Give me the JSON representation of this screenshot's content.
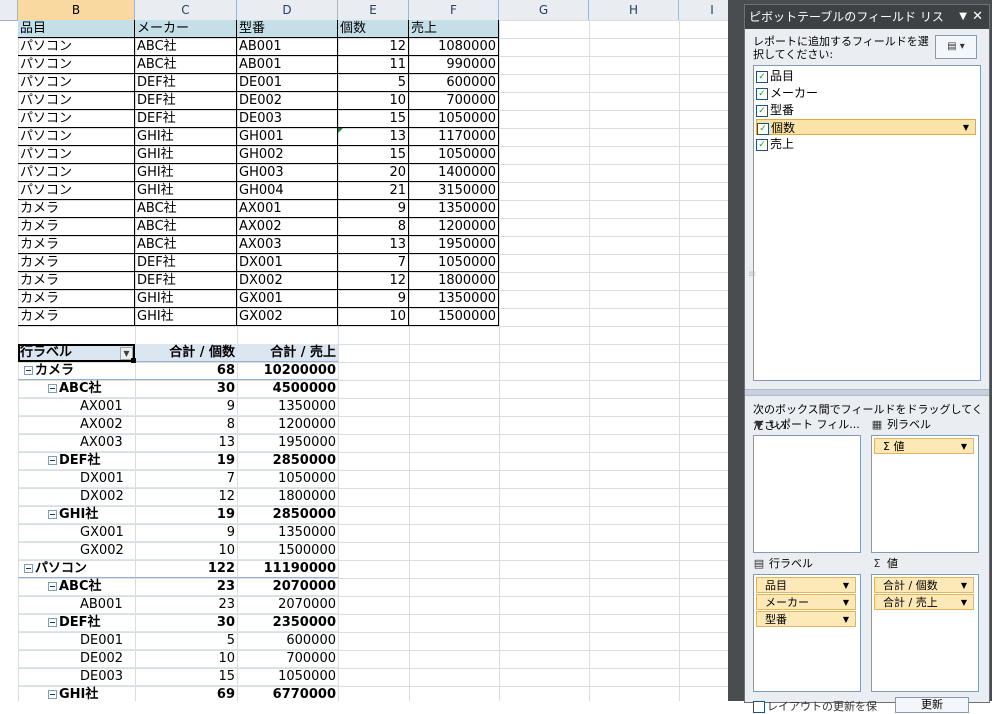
{
  "columns": [
    {
      "letter": "B",
      "active": true
    },
    {
      "letter": "C",
      "active": false
    },
    {
      "letter": "D",
      "active": false
    },
    {
      "letter": "E",
      "active": false
    },
    {
      "letter": "F",
      "active": false
    },
    {
      "letter": "G",
      "active": false
    },
    {
      "letter": "H",
      "active": false
    },
    {
      "letter": "I",
      "active": false
    }
  ],
  "table": {
    "headers": [
      "品目",
      "メーカー",
      "型番",
      "個数",
      "売上"
    ],
    "rows": [
      [
        "パソコン",
        "ABC社",
        "AB001",
        "12",
        "1080000"
      ],
      [
        "パソコン",
        "ABC社",
        "AB001",
        "11",
        "990000"
      ],
      [
        "パソコン",
        "DEF社",
        "DE001",
        "5",
        "600000"
      ],
      [
        "パソコン",
        "DEF社",
        "DE002",
        "10",
        "700000"
      ],
      [
        "パソコン",
        "DEF社",
        "DE003",
        "15",
        "1050000"
      ],
      [
        "パソコン",
        "GHI社",
        "GH001",
        "13",
        "1170000"
      ],
      [
        "パソコン",
        "GHI社",
        "GH002",
        "15",
        "1050000"
      ],
      [
        "パソコン",
        "GHI社",
        "GH003",
        "20",
        "1400000"
      ],
      [
        "パソコン",
        "GHI社",
        "GH004",
        "21",
        "3150000"
      ],
      [
        "カメラ",
        "ABC社",
        "AX001",
        "9",
        "1350000"
      ],
      [
        "カメラ",
        "ABC社",
        "AX002",
        "8",
        "1200000"
      ],
      [
        "カメラ",
        "ABC社",
        "AX003",
        "13",
        "1950000"
      ],
      [
        "カメラ",
        "DEF社",
        "DX001",
        "7",
        "1050000"
      ],
      [
        "カメラ",
        "DEF社",
        "DX002",
        "12",
        "1800000"
      ],
      [
        "カメラ",
        "GHI社",
        "GX001",
        "9",
        "1350000"
      ],
      [
        "カメラ",
        "GHI社",
        "GX002",
        "10",
        "1500000"
      ]
    ]
  },
  "pivot": {
    "headers": [
      "行ラベル",
      "合計 / 個数",
      "合計 / 売上"
    ],
    "rows": [
      {
        "level": 0,
        "label": "カメラ",
        "count": "68",
        "sales": "10200000"
      },
      {
        "level": 1,
        "label": "ABC社",
        "count": "30",
        "sales": "4500000"
      },
      {
        "level": 2,
        "label": "AX001",
        "count": "9",
        "sales": "1350000"
      },
      {
        "level": 2,
        "label": "AX002",
        "count": "8",
        "sales": "1200000"
      },
      {
        "level": 2,
        "label": "AX003",
        "count": "13",
        "sales": "1950000"
      },
      {
        "level": 1,
        "label": "DEF社",
        "count": "19",
        "sales": "2850000"
      },
      {
        "level": 2,
        "label": "DX001",
        "count": "7",
        "sales": "1050000"
      },
      {
        "level": 2,
        "label": "DX002",
        "count": "12",
        "sales": "1800000"
      },
      {
        "level": 1,
        "label": "GHI社",
        "count": "19",
        "sales": "2850000"
      },
      {
        "level": 2,
        "label": "GX001",
        "count": "9",
        "sales": "1350000"
      },
      {
        "level": 2,
        "label": "GX002",
        "count": "10",
        "sales": "1500000"
      },
      {
        "level": 0,
        "label": "パソコン",
        "count": "122",
        "sales": "11190000"
      },
      {
        "level": 1,
        "label": "ABC社",
        "count": "23",
        "sales": "2070000"
      },
      {
        "level": 2,
        "label": "AB001",
        "count": "23",
        "sales": "2070000"
      },
      {
        "level": 1,
        "label": "DEF社",
        "count": "30",
        "sales": "2350000"
      },
      {
        "level": 2,
        "label": "DE001",
        "count": "5",
        "sales": "600000"
      },
      {
        "level": 2,
        "label": "DE002",
        "count": "10",
        "sales": "700000"
      },
      {
        "level": 2,
        "label": "DE003",
        "count": "15",
        "sales": "1050000"
      },
      {
        "level": 1,
        "label": "GHI社",
        "count": "69",
        "sales": "6770000"
      }
    ]
  },
  "pane": {
    "title": "ピボットテーブルのフィールド リス",
    "choose_label": "レポートに追加するフィールドを選択してください:",
    "fields": [
      {
        "label": "品目",
        "checked": true,
        "selected": false
      },
      {
        "label": "メーカー",
        "checked": true,
        "selected": false
      },
      {
        "label": "型番",
        "checked": true,
        "selected": false
      },
      {
        "label": "個数",
        "checked": true,
        "selected": true
      },
      {
        "label": "売上",
        "checked": true,
        "selected": false
      }
    ],
    "drag_label": "次のボックス間でフィールドをドラッグしてください:",
    "areas": {
      "filter_label": "レポート フィル...",
      "columns_label": "列ラベル",
      "rows_label": "行ラベル",
      "values_label": "値",
      "columns_items": [
        "Σ 値"
      ],
      "rows_items": [
        "品目",
        "メーカー",
        "型番"
      ],
      "values_items": [
        "合計 / 個数",
        "合計 / 売上"
      ]
    },
    "defer_label": "レイアウトの更新を保",
    "update_label": "更新"
  }
}
